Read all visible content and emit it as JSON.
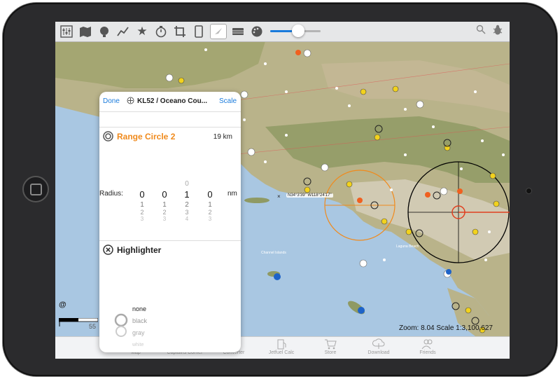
{
  "toolbar": {
    "icons": [
      "settings-sliders",
      "map-book",
      "globe-plane",
      "route",
      "star",
      "timer",
      "crop",
      "tablet",
      "compass",
      "layers",
      "palette",
      "search",
      "bug"
    ],
    "brightness_percent": 55
  },
  "panel": {
    "done_label": "Done",
    "title": "KL52 / Oceano Cou...",
    "scale_label": "Scale",
    "range": {
      "title": "Range Circle 2",
      "value": "19 km",
      "radius_label": "Radius:",
      "unit": "nm",
      "digits": [
        {
          "above": "",
          "selected": "0",
          "below": [
            "1",
            "2",
            "3"
          ]
        },
        {
          "above": "",
          "selected": "0",
          "below": [
            "1",
            "2",
            "3"
          ]
        },
        {
          "above": "0",
          "selected": "1",
          "below": [
            "2",
            "3",
            "4"
          ]
        },
        {
          "above": "",
          "selected": "0",
          "below": [
            "1",
            "2",
            "3"
          ]
        }
      ]
    },
    "highlighter": {
      "title": "Highlighter",
      "colors": [
        "none",
        "black",
        "gray",
        "white"
      ]
    }
  },
  "map": {
    "cursor_label": "N34°3'39\"  W118°24'17\"",
    "channel_islands": "Channel Islands",
    "laguna_beach": "Laguna Beach",
    "zoom_text": "Zoom: 8.04  Scale 1:3,100,627",
    "scale_number": "55",
    "at_sign": "@",
    "colors": {
      "land": "#b9b38a",
      "mountain": "#8f9a64",
      "water": "#a9c7e2",
      "urban": "#d9d2c0",
      "range_circle": "#f08a1c",
      "active_circle": "#000000"
    }
  },
  "tabs": [
    {
      "label": "Map",
      "icon": "map-icon"
    },
    {
      "label": "Captains Corner",
      "icon": "captain-icon"
    },
    {
      "label": "Converter",
      "icon": "converter-icon"
    },
    {
      "label": "Jetfuel Calc",
      "icon": "fuel-pump-icon"
    },
    {
      "label": "Store",
      "icon": "cart-icon"
    },
    {
      "label": "Download",
      "icon": "cloud-download-icon"
    },
    {
      "label": "Friends",
      "icon": "friends-icon"
    }
  ]
}
